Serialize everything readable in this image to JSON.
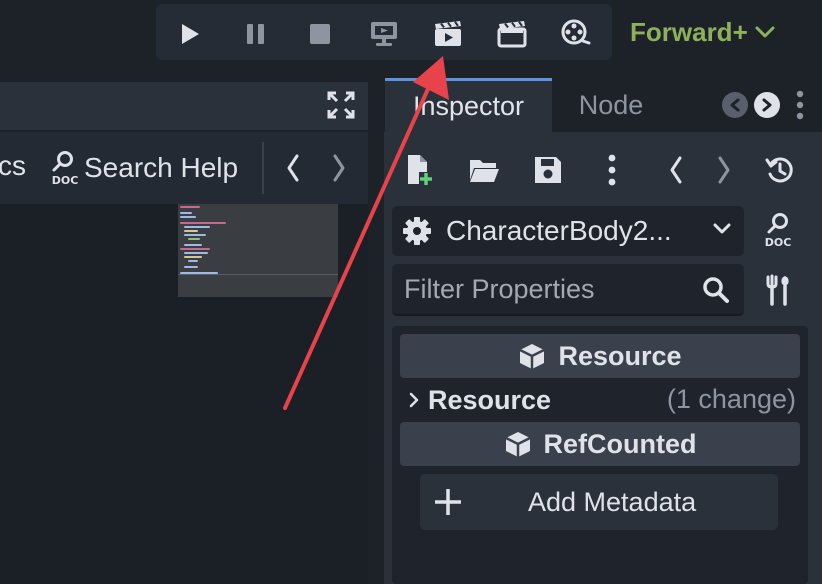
{
  "run_toolbar": {
    "buttons": [
      {
        "name": "play-icon"
      },
      {
        "name": "pause-icon"
      },
      {
        "name": "stop-icon"
      },
      {
        "name": "remote-debug-icon"
      },
      {
        "name": "play-scene-icon"
      },
      {
        "name": "play-custom-scene-icon"
      },
      {
        "name": "movie-maker-icon"
      }
    ],
    "renderer_label": "Forward+"
  },
  "script_panel": {
    "partial_label": "cs",
    "search_help_label": "Search Help"
  },
  "inspector": {
    "tabs": [
      {
        "label": "Inspector",
        "active": true
      },
      {
        "label": "Node",
        "active": false
      }
    ],
    "object_name": "CharacterBody2...",
    "filter_placeholder": "Filter Properties",
    "categories": [
      {
        "label": "Resource"
      },
      {
        "label": "RefCounted"
      }
    ],
    "section": {
      "label": "Resource",
      "note": "(1 change)"
    },
    "add_metadata_label": "Add Metadata"
  },
  "colors": {
    "accent": "#5f93d9",
    "renderer_green": "#8eb05a",
    "annotation_arrow": "#e8434b",
    "new_resource_plus": "#5fd07a"
  }
}
